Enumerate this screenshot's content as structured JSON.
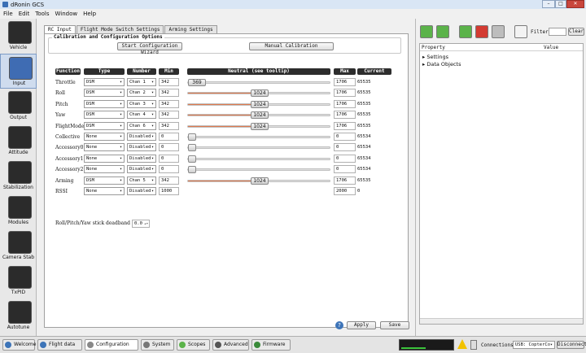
{
  "window": {
    "title": "dRonin GCS",
    "min": "–",
    "max": "□",
    "close": "✕"
  },
  "menu": [
    "File",
    "Edit",
    "Tools",
    "Window",
    "Help"
  ],
  "sidebar": [
    {
      "label": "Vehicle",
      "icon": "vehicle-icon"
    },
    {
      "label": "Input",
      "icon": "joystick-icon",
      "active": true
    },
    {
      "label": "Output",
      "icon": "output-icon"
    },
    {
      "label": "Attitude",
      "icon": "attitude-icon"
    },
    {
      "label": "Stabilization",
      "icon": "stabilization-icon"
    },
    {
      "label": "Modules",
      "icon": "modules-icon"
    },
    {
      "label": "Camera Stab",
      "icon": "camera-icon"
    },
    {
      "label": "TxPID",
      "icon": "txpid-icon"
    },
    {
      "label": "Autotune",
      "icon": "autotune-icon"
    }
  ],
  "tabs": [
    "RC Input",
    "Flight Mode Switch Settings",
    "Arming Settings"
  ],
  "calibration": {
    "group_title": "Calibration and Configuration Options",
    "wizard_button": "Start Configuration Wizard",
    "manual_button": "Manual Calibration"
  },
  "columns": [
    "Function",
    "Type",
    "Number",
    "Min",
    "Neutral (see tooltip)",
    "Max",
    "Current"
  ],
  "rows": [
    {
      "function": "Throttle",
      "type": "DSM",
      "number": "Chan 1",
      "min": "342",
      "neutral": "369",
      "max": "1706",
      "current": "65535",
      "level": 0.02
    },
    {
      "function": "Roll",
      "type": "DSM",
      "number": "Chan 2",
      "min": "342",
      "neutral": "1024",
      "max": "1706",
      "current": "65535",
      "level": 0.5
    },
    {
      "function": "Pitch",
      "type": "DSM",
      "number": "Chan 3",
      "min": "342",
      "neutral": "1024",
      "max": "1706",
      "current": "65535",
      "level": 0.5
    },
    {
      "function": "Yaw",
      "type": "DSM",
      "number": "Chan 4",
      "min": "342",
      "neutral": "1024",
      "max": "1706",
      "current": "65535",
      "level": 0.5
    },
    {
      "function": "FlightMode",
      "type": "DSM",
      "number": "Chan 6",
      "min": "342",
      "neutral": "1024",
      "max": "1706",
      "current": "65535",
      "level": 0.5
    },
    {
      "function": "Collective",
      "type": "None",
      "number": "Disabled",
      "min": "0",
      "neutral": "",
      "max": "0",
      "current": "65534",
      "level": 0
    },
    {
      "function": "Accessory0",
      "type": "None",
      "number": "Disabled",
      "min": "0",
      "neutral": "",
      "max": "0",
      "current": "65534",
      "level": 0
    },
    {
      "function": "Accessory1",
      "type": "None",
      "number": "Disabled",
      "min": "0",
      "neutral": "",
      "max": "0",
      "current": "65534",
      "level": 0
    },
    {
      "function": "Accessory2",
      "type": "None",
      "number": "Disabled",
      "min": "0",
      "neutral": "",
      "max": "0",
      "current": "65534",
      "level": 0
    },
    {
      "function": "Arming",
      "type": "DSM",
      "number": "Chan 5",
      "min": "342",
      "neutral": "1024",
      "max": "1706",
      "current": "65535",
      "level": 0.5
    },
    {
      "function": "RSSI",
      "type": "None",
      "number": "Disabled",
      "min": "1000",
      "neutral": null,
      "max": "2000",
      "current": "0",
      "level": 0
    }
  ],
  "deadband": {
    "label": "Roll/Pitch/Yaw stick deadband",
    "value": "0.0"
  },
  "actions": {
    "apply": "Apply",
    "save": "Save"
  },
  "uavbrowser": {
    "filter_label": "Filter",
    "clear_button": "Clear",
    "columns": [
      "Property",
      "Value"
    ],
    "items": [
      "Settings",
      "Data Objects"
    ]
  },
  "statusbar": {
    "tabs": [
      "Welcome",
      "Flight data",
      "Configuration",
      "System",
      "Scopes",
      "Advanced",
      "Firmware"
    ],
    "active_tab": "Configuration",
    "connections_label": "Connections:",
    "connection_value": "USB: CopterCo",
    "disconnect_button": "Disconnect"
  },
  "colors": {
    "slider_fill": "#e07a4e",
    "accent": "#3d74b8"
  }
}
